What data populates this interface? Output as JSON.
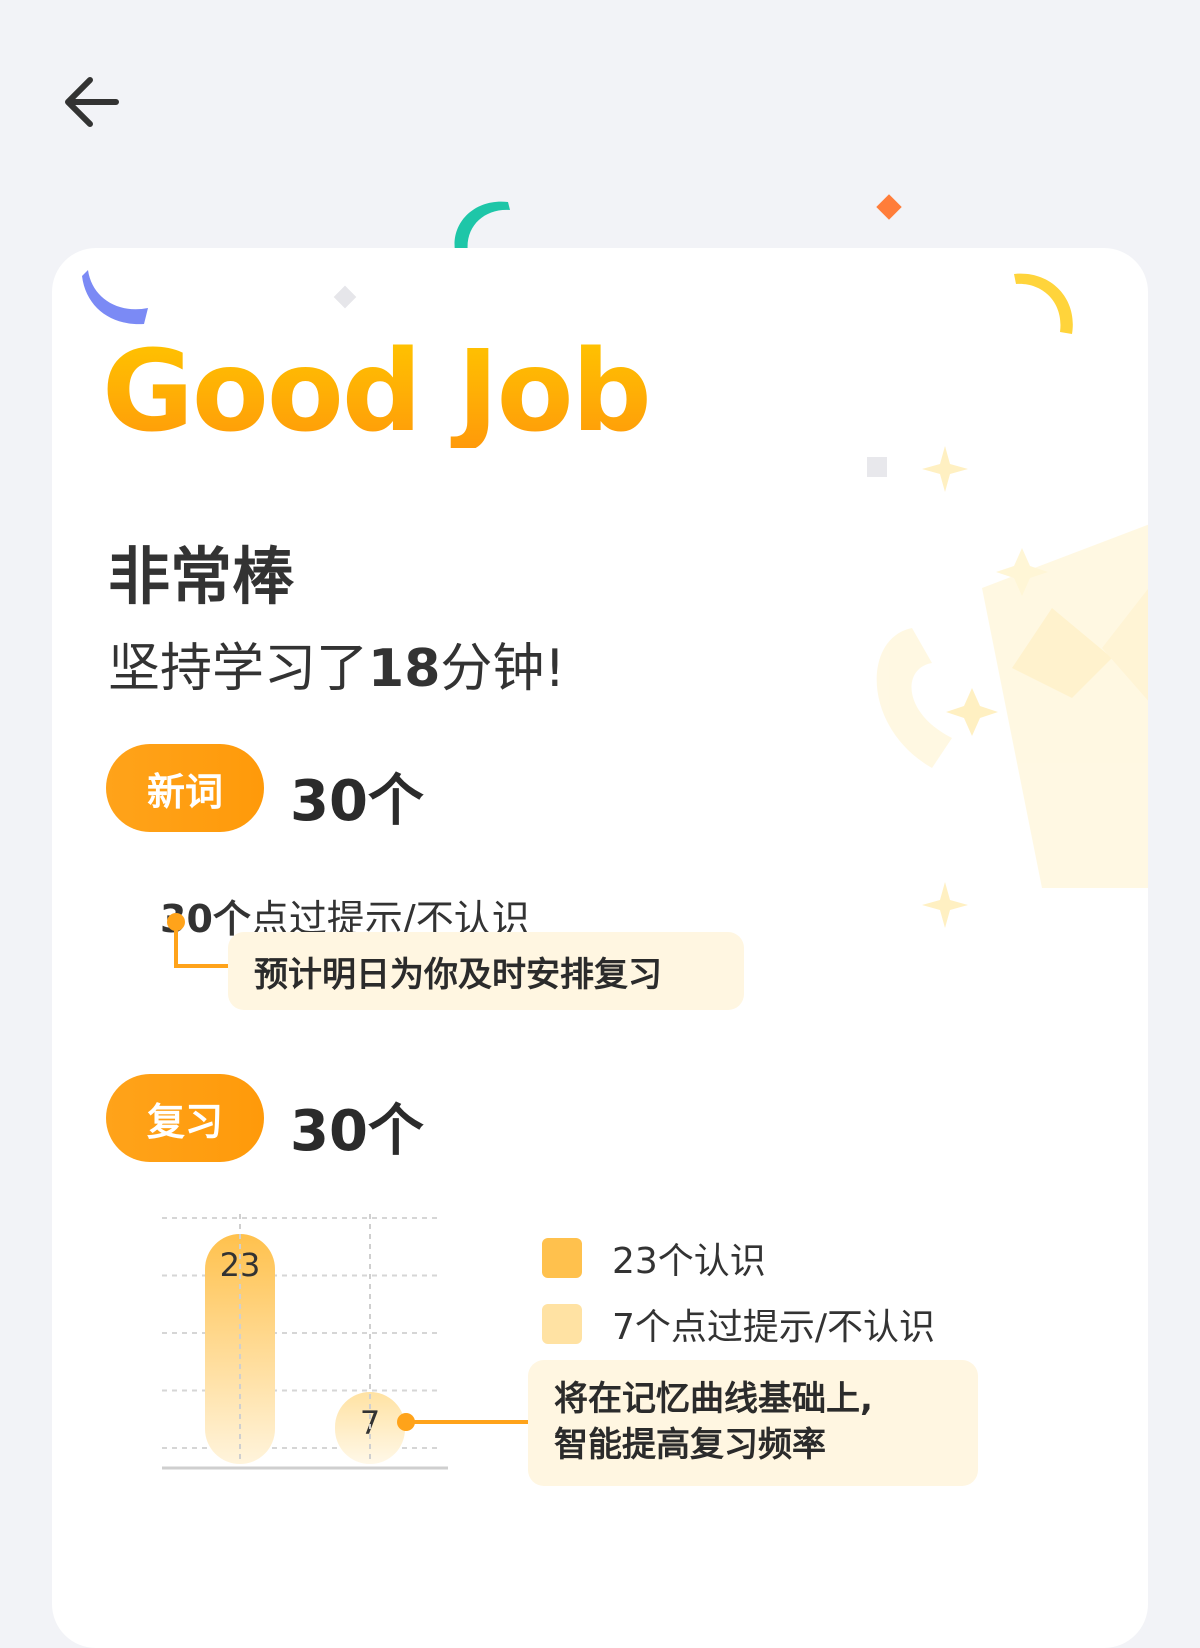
{
  "nav": {
    "back_icon": "arrow-left-icon"
  },
  "hero": {
    "title": "Good Job",
    "headline": "非常棒",
    "study_prefix": "坚持学习了",
    "study_minutes": "18",
    "study_suffix": "分钟!"
  },
  "new_words": {
    "badge": "新词",
    "count": "30个",
    "detail_count": "30个",
    "detail_text": "点过提示/不认识",
    "callout": "预计明日为你及时安排复习"
  },
  "review": {
    "badge": "复习",
    "count": "30个",
    "legend": [
      {
        "label": "23个认识",
        "color": "#ffc14d"
      },
      {
        "label": "7个点过提示/不认识",
        "color": "#ffe2a3"
      }
    ],
    "callout_line1": "将在记忆曲线基础上,",
    "callout_line2": "智能提高复习频率"
  },
  "chart_data": {
    "type": "bar",
    "categories": [
      "认识",
      "点过提示/不认识"
    ],
    "values": [
      23,
      7
    ],
    "data_labels": [
      "23",
      "7"
    ],
    "ylim": [
      0,
      25
    ],
    "grid": true
  },
  "colors": {
    "accent": "#ffa31a",
    "bar_known": "#ffc14d",
    "bar_unknown": "#ffe2a3",
    "callout_bg": "#fff6e1",
    "page_bg": "#f2f3f7"
  }
}
